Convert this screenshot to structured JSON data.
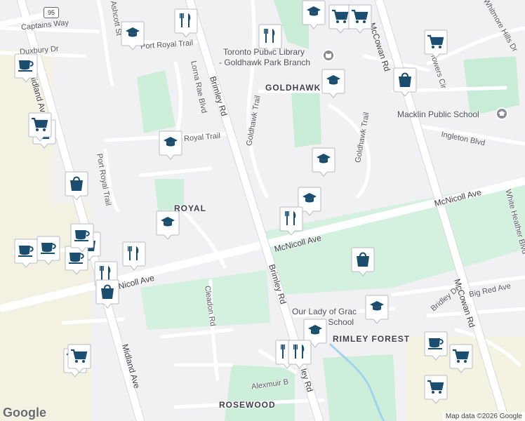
{
  "map": {
    "highway_shield": "95",
    "attribution": "Map data ©2026 Google",
    "logo": "Google"
  },
  "streets": {
    "captains_way": "Captains Way",
    "ashcott": "Ashcott St",
    "duxbury": "Duxbury Dr",
    "midland_top": "Midland Ave",
    "port_royal_trail_top": "Port Royal Trail",
    "lorna_rae": "Lorna Rae Blvd",
    "brimley_top": "Brimley Rd",
    "goldhawk_trail_left": "Goldhawk Trail",
    "goldhawk_trail_right": "Goldhawk Trail",
    "alton_towers": "Alton Towers Cir",
    "whitmore_hills": "Whitmore Hills Dr",
    "mccowan_top": "McCowan Rd",
    "ingleton": "Ingleton Blvd",
    "port_royal_trail_mid": "Royal Trail",
    "port_royal_trail_vert": "Port Royal Trail",
    "mcnicoll_right": "McNicoll Ave",
    "mcnicoll_mid": "McNicoll Ave",
    "mcnicoll_left": "Nicoll Ave",
    "white_heather": "White Heather Blvd",
    "mccowan_mid": "McCowan Rd",
    "brimley_mid": "Brimley Rd",
    "cleadon": "Cleadon Rd",
    "bridley": "Bridley Dr",
    "big_red": "Big Red Ave",
    "midland_bottom": "Midland Ave",
    "alexmuir": "Alexmuir B",
    "brimley_bottom": "ley Rd"
  },
  "neighborhoods": {
    "goldhawk": "GOLDHAWK",
    "port_royal": "ROYAL",
    "brimley_forest": "RIMLEY FOREST",
    "rosewood": "ROSEWOOD"
  },
  "places": {
    "library_line1": "Toronto Public Library",
    "library_line2": "- Goldhawk Park Branch",
    "macklin": "Macklin Public School",
    "our_lady_line1": "Our Lady of Grac",
    "our_lady_line2": "blic School"
  },
  "pins": [
    {
      "type": "school"
    },
    {
      "type": "restaurant"
    },
    {
      "type": "cafe"
    },
    {
      "type": "shopping"
    },
    {
      "type": "grocery"
    },
    {
      "type": "school"
    },
    {
      "type": "grocery"
    },
    {
      "type": "grocery"
    },
    {
      "type": "restaurant"
    },
    {
      "type": "grocery"
    },
    {
      "type": "school"
    },
    {
      "type": "shopping"
    },
    {
      "type": "school"
    },
    {
      "type": "school"
    },
    {
      "type": "shopping"
    },
    {
      "type": "school"
    },
    {
      "type": "restaurant"
    },
    {
      "type": "school"
    },
    {
      "type": "cafe"
    },
    {
      "type": "shopping"
    },
    {
      "type": "cafe"
    },
    {
      "type": "cafe"
    },
    {
      "type": "restaurant"
    },
    {
      "type": "cafe"
    },
    {
      "type": "restaurant"
    },
    {
      "type": "shopping"
    },
    {
      "type": "shopping"
    },
    {
      "type": "school"
    },
    {
      "type": "school"
    },
    {
      "type": "restaurant"
    },
    {
      "type": "restaurant"
    },
    {
      "type": "cafe"
    },
    {
      "type": "grocery"
    },
    {
      "type": "grocery"
    },
    {
      "type": "grocery"
    },
    {
      "type": "grocery"
    }
  ],
  "colors": {
    "pin_fill": "#ffffff",
    "pin_icon": "#1a4d6e",
    "park": "#c8ecd6",
    "commercial": "#f1efe0",
    "major_road": "#ffffff",
    "minor_road": "#fafafa"
  }
}
